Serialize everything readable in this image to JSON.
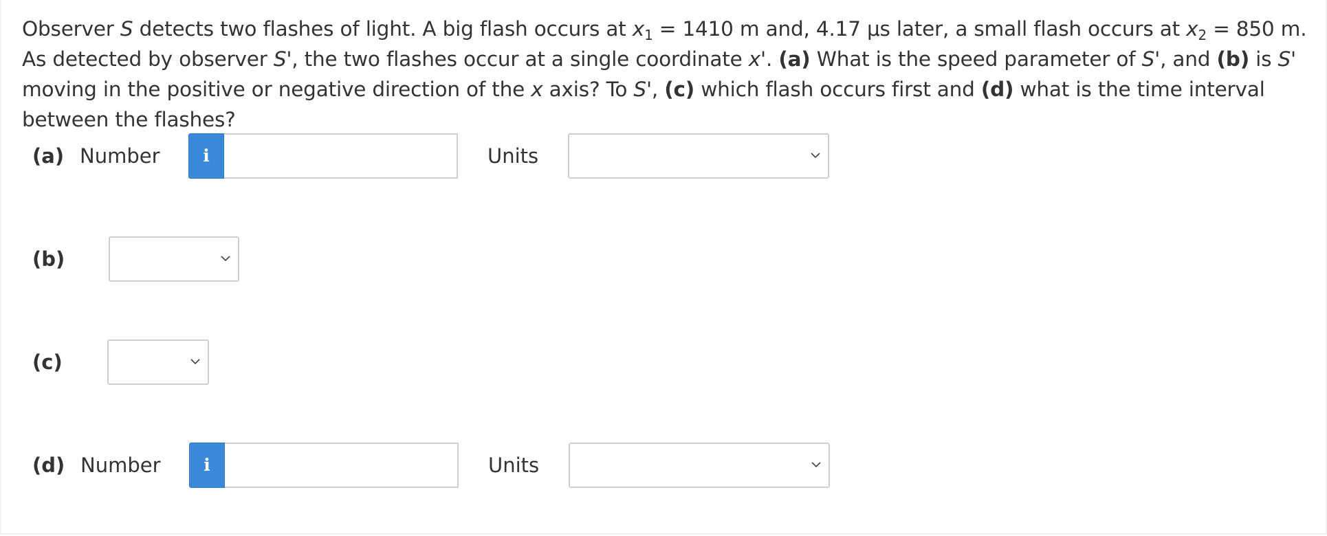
{
  "question": {
    "t1": "Observer ",
    "S": "S",
    "t2": " detects two flashes of light. A big flash occurs at ",
    "x": "x",
    "sub1": "1",
    "t3": " = 1410 m and, 4.17 μs later, a small flash occurs at ",
    "x_b": "x",
    "sub2": "2",
    "t4": " = 850 m. As detected by observer ",
    "Sp1": "S'",
    "t5": ", the two flashes occur at a single coordinate ",
    "xp": "x'",
    "t6": ". ",
    "a": "(a)",
    "t7": " What is the speed parameter of ",
    "Sp2": "S'",
    "t8": ", and ",
    "b": "(b)",
    "t9": " is ",
    "Sp3": "S'",
    "t10": " moving in the positive or negative direction of the ",
    "x_c": "x",
    "t11": " axis? To ",
    "Sp4": "S'",
    "t12": ", ",
    "c": "(c)",
    "t13": " which flash occurs first and ",
    "d": "(d)",
    "t14": " what is the time interval between the flashes?"
  },
  "parts": {
    "a": {
      "label": "(a)",
      "number_label": "Number",
      "info_icon": "i",
      "number_value": "",
      "units_label": "Units",
      "units_value": ""
    },
    "b": {
      "label": "(b)",
      "select_value": ""
    },
    "c": {
      "label": "(c)",
      "select_value": ""
    },
    "d": {
      "label": "(d)",
      "number_label": "Number",
      "info_icon": "i",
      "number_value": "",
      "units_label": "Units",
      "units_value": ""
    }
  },
  "colors": {
    "info_button": "#3b8ad9",
    "text": "#333333",
    "border": "#cfcfcf"
  }
}
